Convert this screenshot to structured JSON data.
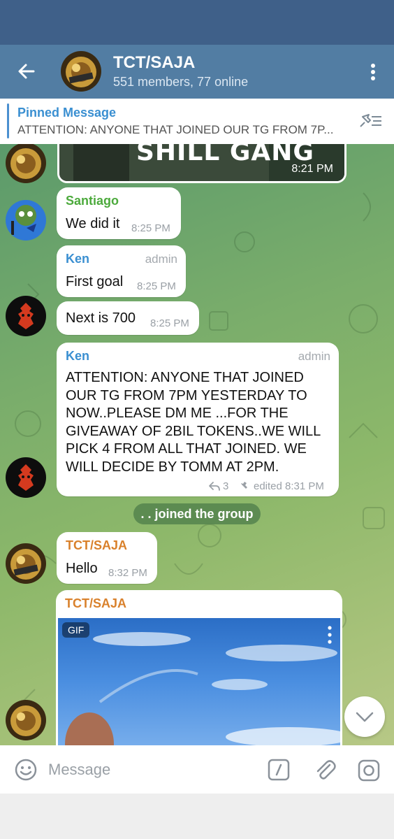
{
  "header": {
    "title": "TCT/SAJA",
    "subtitle": "551 members, 77 online"
  },
  "pinned": {
    "title": "Pinned Message",
    "text": "ATTENTION: ANYONE THAT JOINED OUR TG FROM 7P..."
  },
  "messages": {
    "image_time": "8:21 PM",
    "image_caption": "SHILL GANG",
    "m1": {
      "sender": "Santiago",
      "text": "We did it",
      "time": "8:25 PM"
    },
    "m2": {
      "sender": "Ken",
      "role": "admin",
      "text": "First goal",
      "time": "8:25 PM"
    },
    "m3": {
      "text": "Next is 700",
      "time": "8:25 PM"
    },
    "m4": {
      "sender": "Ken",
      "role": "admin",
      "lines": [
        "ATTENTION: ANYONE THAT JOINED",
        "OUR TG FROM 7PM YESTERDAY TO",
        "NOW..PLEASE DM ME ...FOR THE",
        "GIVEAWAY OF 2BIL TOKENS..WE WILL",
        "PICK 4 FROM ALL THAT JOINED. WE",
        "WILL DECIDE BY TOMM AT 2PM."
      ],
      "replies": "3",
      "meta": "edited 8:31 PM"
    },
    "service": ". . joined the group",
    "m5": {
      "sender": "TCT/SAJA",
      "text": "Hello",
      "time": "8:32 PM"
    },
    "m6": {
      "sender": "TCT/SAJA",
      "gif_label": "GIF"
    }
  },
  "input": {
    "placeholder": "Message"
  },
  "colors": {
    "header": "#527da3",
    "statusbar": "#3f6089",
    "name_green": "#4caa3c",
    "name_blue": "#3a8fd1",
    "name_orange": "#d9812c"
  }
}
